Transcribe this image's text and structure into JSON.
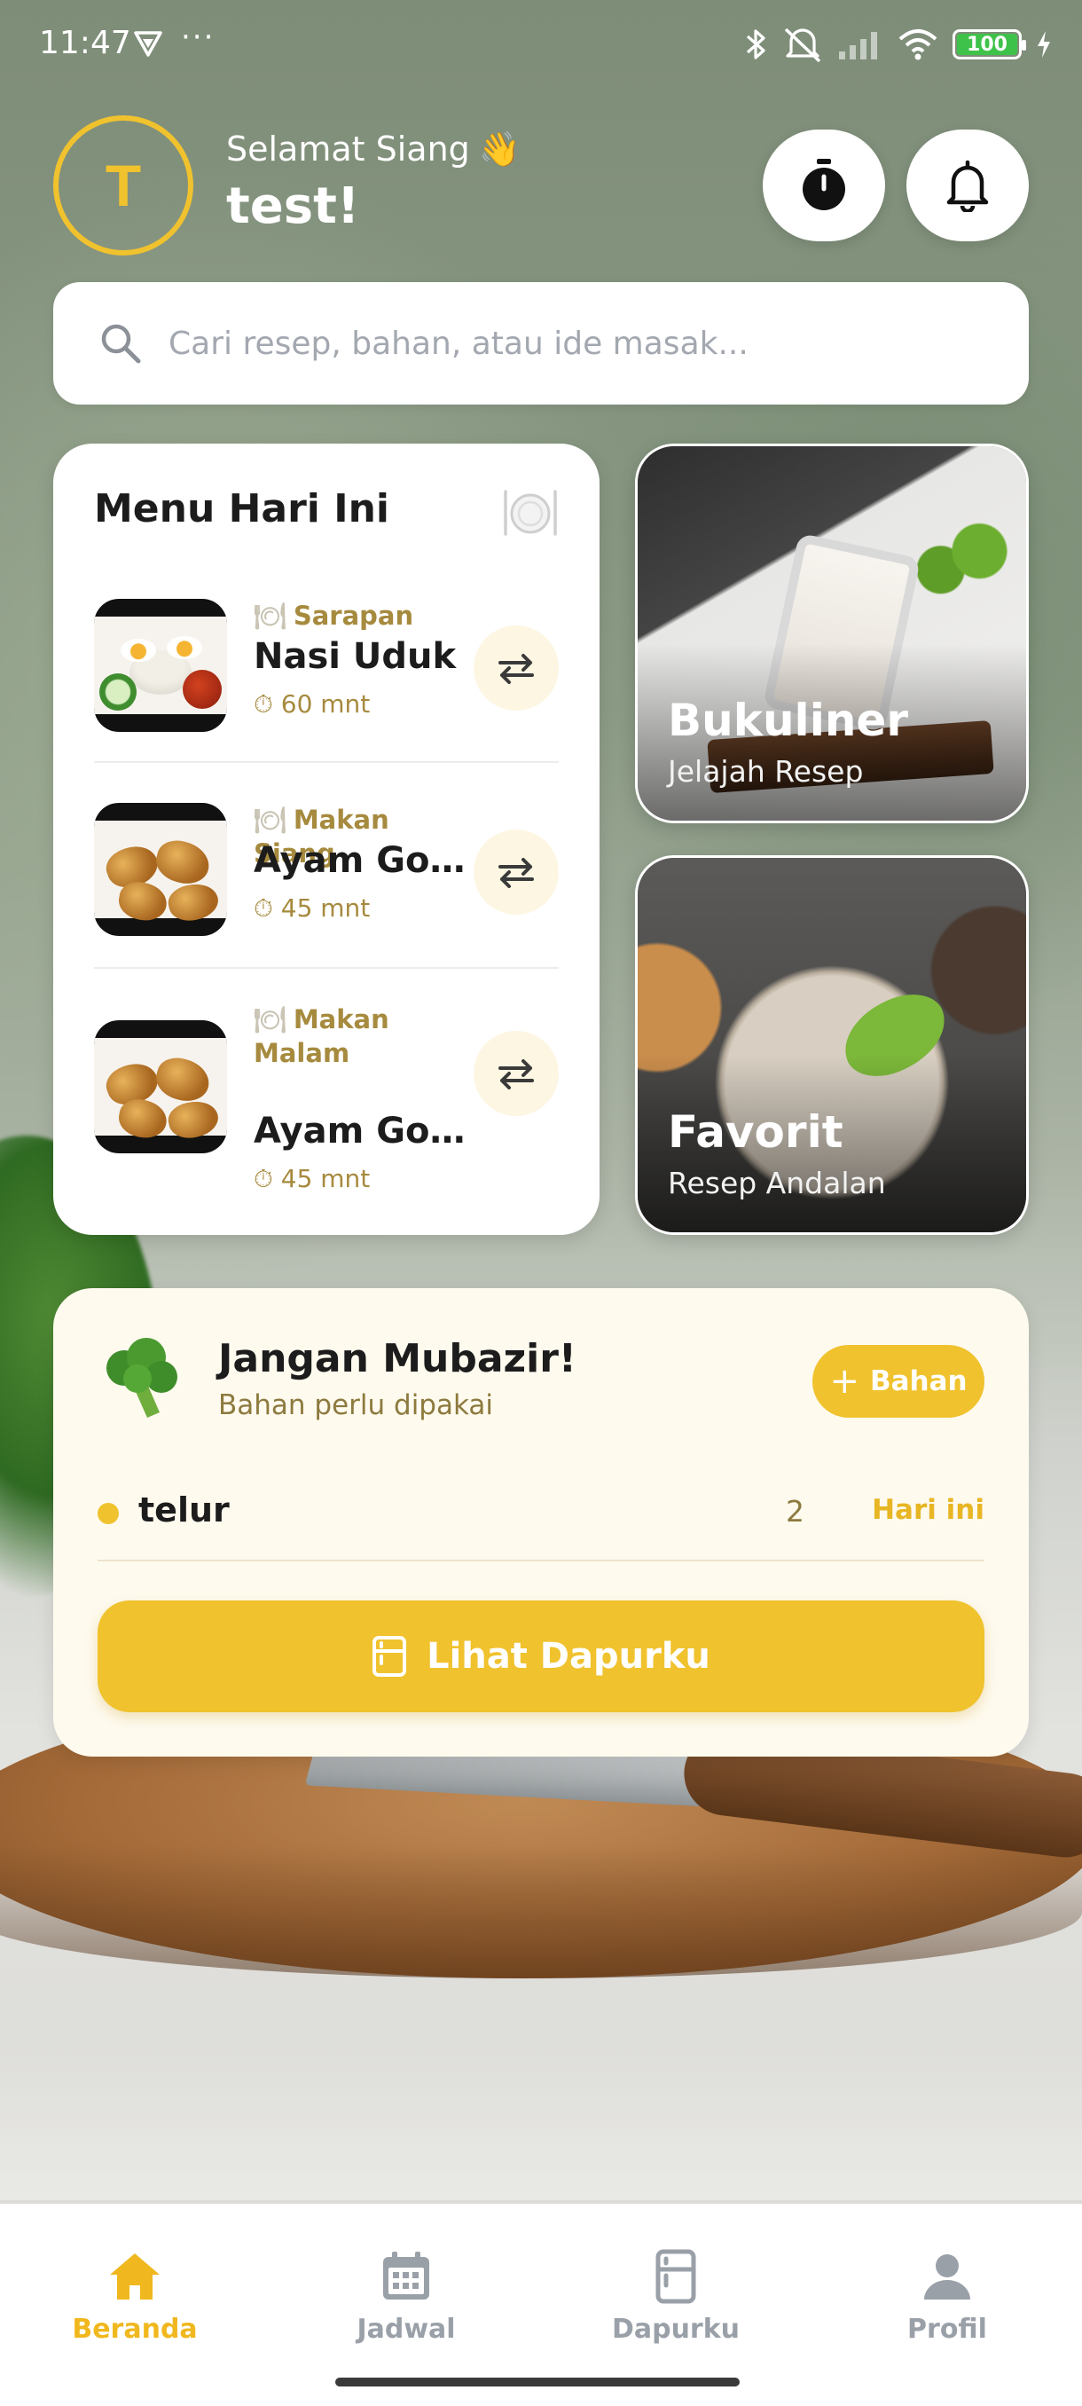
{
  "status_bar": {
    "time": "11:47",
    "dots": "···",
    "battery": "100",
    "icons": [
      "vpn-icon",
      "bluetooth-icon",
      "mute-icon",
      "signal-icon",
      "wifi-icon",
      "battery-icon",
      "charging-icon"
    ]
  },
  "header": {
    "avatar_initial": "T",
    "greeting": "Selamat Siang",
    "greeting_emoji": "👋",
    "username": "test!",
    "icons": [
      "stopwatch-icon",
      "bell-icon"
    ]
  },
  "search": {
    "placeholder": "Cari resep, bahan, atau ide masak..."
  },
  "menu_today": {
    "title": "Menu Hari Ini",
    "plate_icon": "🍽️",
    "items": [
      {
        "category": "Sarapan",
        "name": "Nasi Uduk",
        "time": "60 mnt"
      },
      {
        "category": "Makan Siang",
        "name": "Ayam Goreng Kremes",
        "time": "45 mnt"
      },
      {
        "category": "Makan Malam",
        "name": "Ayam Goreng Kremes",
        "time": "45 mnt"
      }
    ]
  },
  "tiles": {
    "bukuliner": {
      "title": "Bukuliner",
      "subtitle": "Jelajah Resep"
    },
    "favorit": {
      "title": "Favorit",
      "subtitle": "Resep Andalan"
    }
  },
  "waste": {
    "emoji": "🥦",
    "title": "Jangan Mubazir!",
    "subtitle": "Bahan perlu dipakai",
    "add_label": "Bahan",
    "ingredient": {
      "name": "telur",
      "qty": "2",
      "when": "Hari ini"
    },
    "cta_label": "Lihat Dapurku"
  },
  "bottom_nav": [
    {
      "label": "Beranda",
      "icon": "home-icon",
      "active": true
    },
    {
      "label": "Jadwal",
      "icon": "calendar-icon",
      "active": false
    },
    {
      "label": "Dapurku",
      "icon": "fridge-icon",
      "active": false
    },
    {
      "label": "Profil",
      "icon": "person-icon",
      "active": false
    }
  ],
  "colors": {
    "accent": "#f0c22e",
    "accent_text": "#a68a3e",
    "card": "#ffffff",
    "waste_card": "#fefaee",
    "nav_inactive": "#9aa0a8"
  }
}
